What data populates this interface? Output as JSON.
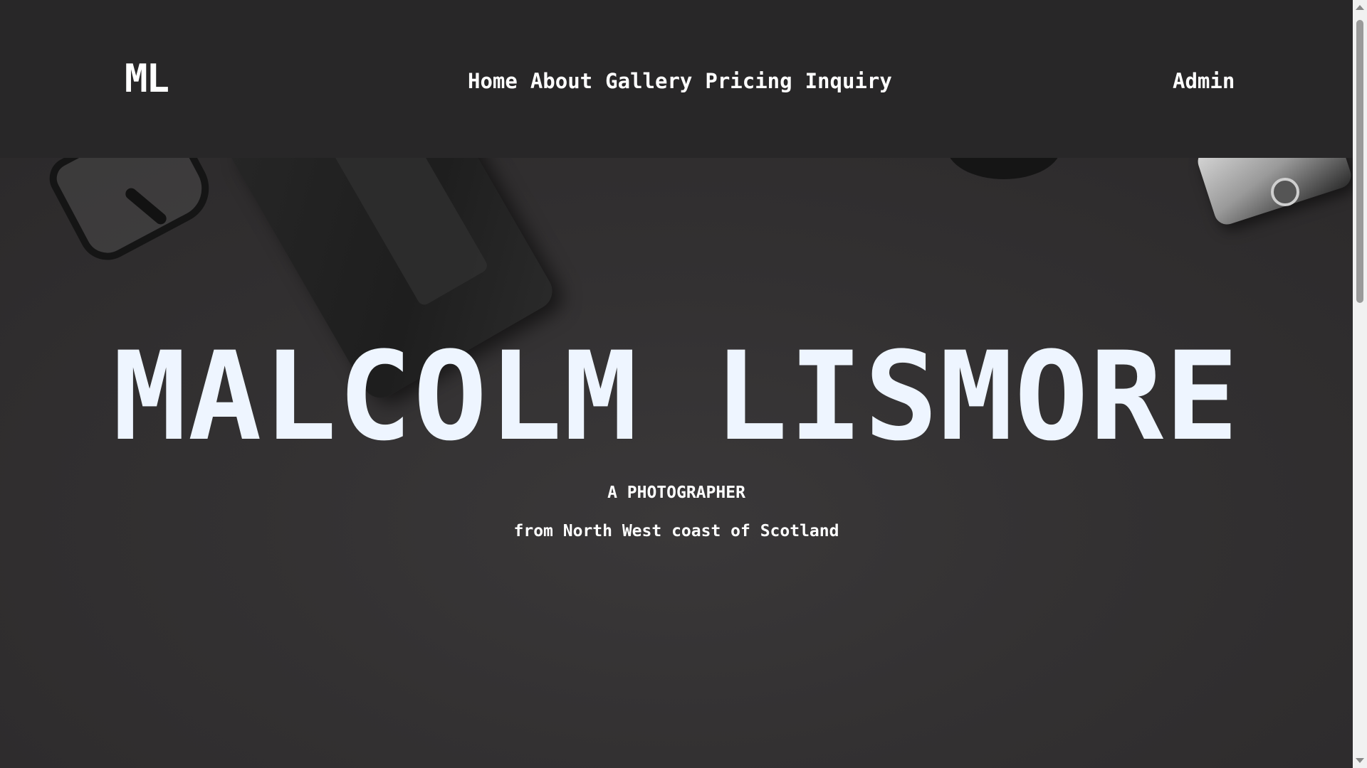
{
  "navbar": {
    "logo": "ML",
    "links": [
      {
        "label": "Home"
      },
      {
        "label": "About"
      },
      {
        "label": "Gallery"
      },
      {
        "label": "Pricing"
      },
      {
        "label": "Inquiry"
      }
    ],
    "admin_label": "Admin"
  },
  "hero": {
    "title": "MALCOLM LISMORE",
    "subtitle": "A PHOTOGRAPHER",
    "tagline": "from North West coast of Scotland",
    "background_image": "desk-with-glasses-notebook-camera"
  },
  "colors": {
    "navbar_bg": "#282728",
    "hero_bg": "#333132",
    "title_color": "#eef5ff",
    "text_color": "#ffffff"
  }
}
